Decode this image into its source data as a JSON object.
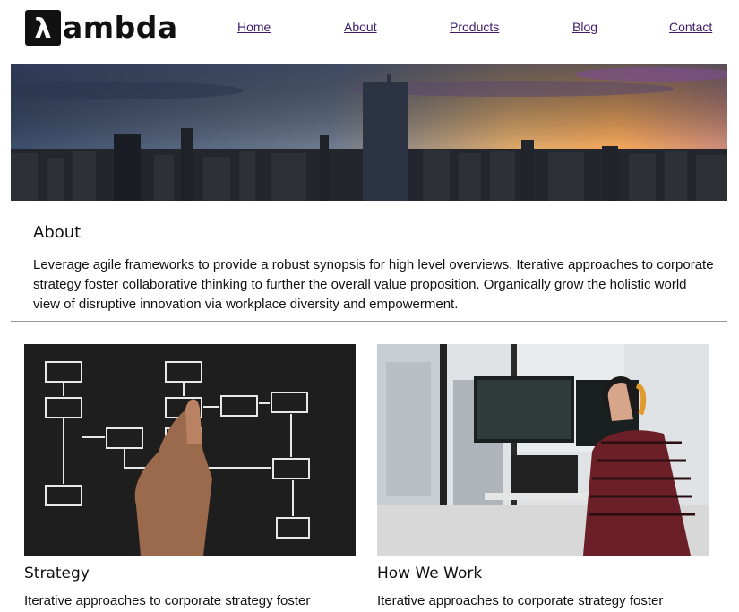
{
  "brand": {
    "logo_text": "ambda",
    "logo_glyph": "λ"
  },
  "nav": [
    {
      "label": "Home"
    },
    {
      "label": "About"
    },
    {
      "label": "Products"
    },
    {
      "label": "Blog"
    },
    {
      "label": "Contact"
    }
  ],
  "colors": {
    "nav_link": "#3f1d68",
    "text": "#111111",
    "divider": "#999999"
  },
  "about": {
    "title": "About",
    "body": "Leverage agile frameworks to provide a robust synopsis for high level overviews. Iterative approaches to corporate strategy foster collaborative thinking to further the overall value proposition. Organically grow the holistic world view of disruptive innovation via workplace diversity and empowerment."
  },
  "cards": [
    {
      "title": "Strategy",
      "text": "Iterative approaches to corporate strategy foster"
    },
    {
      "title": "How We Work",
      "text": "Iterative approaches to corporate strategy foster"
    }
  ]
}
